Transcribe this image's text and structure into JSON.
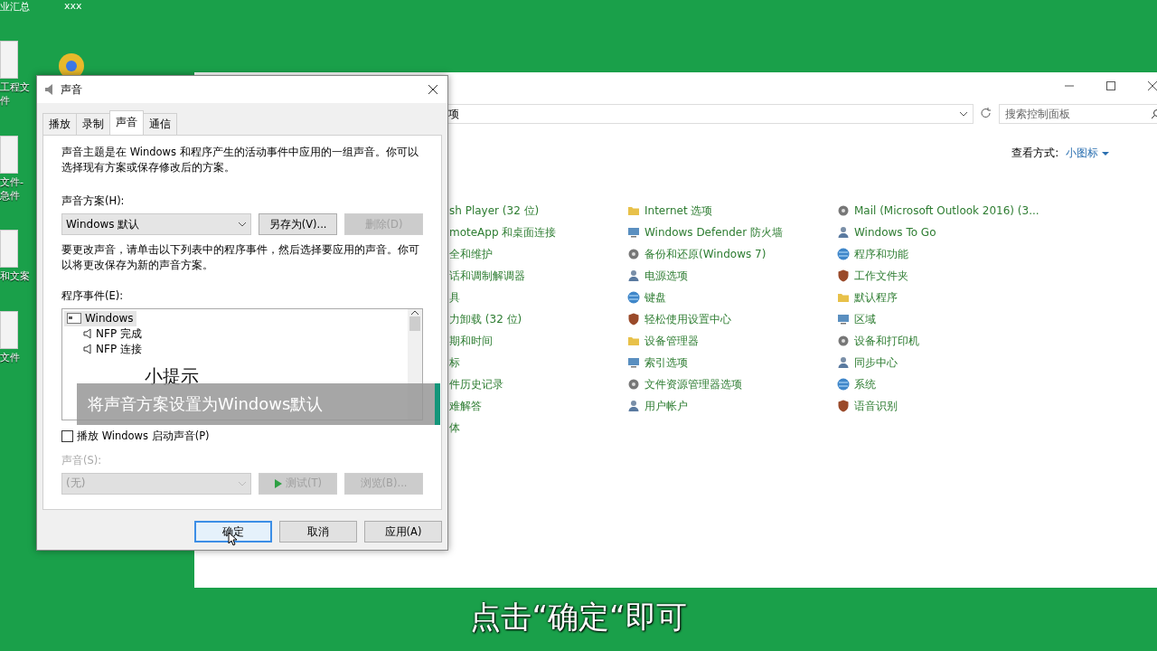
{
  "desktop": {
    "top_labels": [
      "业汇总",
      "xxx"
    ],
    "icons": [
      {
        "label": "工程文件"
      },
      {
        "label": "文件-急件"
      },
      {
        "label": "和文案"
      },
      {
        "label": "文件"
      }
    ]
  },
  "control_panel": {
    "address": "项",
    "search": {
      "placeholder": "搜索控制面板"
    },
    "view_by": {
      "label": "查看方式:",
      "value": "小图标"
    },
    "columns": [
      [
        "sh Player (32 位)",
        "moteApp 和桌面连接",
        "全和维护",
        "话和调制解调器",
        "具",
        "力卸载 (32 位)",
        "期和时间",
        "标",
        "件历史记录",
        "难解答",
        "体"
      ],
      [
        "Internet 选项",
        "Windows Defender 防火墙",
        "备份和还原(Windows 7)",
        "电源选项",
        "键盘",
        "轻松使用设置中心",
        "设备管理器",
        "索引选项",
        "文件资源管理器选项",
        "用户帐户"
      ],
      [
        "Mail (Microsoft Outlook 2016) (3...",
        "Windows To Go",
        "程序和功能",
        "工作文件夹",
        "默认程序",
        "区域",
        "设备和打印机",
        "同步中心",
        "系统",
        "语音识别"
      ]
    ]
  },
  "dialog": {
    "title": "声音",
    "tabs": [
      {
        "label": "播放",
        "selected": false
      },
      {
        "label": "录制",
        "selected": false
      },
      {
        "label": "声音",
        "selected": true
      },
      {
        "label": "通信",
        "selected": false
      }
    ],
    "intro": "声音主题是在 Windows 和程序产生的活动事件中应用的一组声音。你可以选择现有方案或保存修改后的方案。",
    "scheme_label": "声音方案(H):",
    "scheme": "Windows 默认",
    "scheme_buttons": [
      {
        "label": "另存为(V)...",
        "disabled": false
      },
      {
        "label": "删除(D)",
        "disabled": true
      }
    ],
    "hint": "要更改声音，请单击以下列表中的程序事件，然后选择要应用的声音。你可以将更改保存为新的声音方案。",
    "events_label": "程序事件(E):",
    "events": [
      {
        "label": "Windows",
        "selected": true,
        "children": [
          {
            "label": "NFP 完成",
            "selected": false
          },
          {
            "label": "NFP 连接",
            "selected": false
          }
        ]
      }
    ],
    "startup": {
      "label": "播放 Windows 启动声音(P)",
      "checked": false
    },
    "sound_label": "声音(S):",
    "sound": "(无)",
    "sound_disabled": true,
    "sound_buttons": [
      {
        "label": "测试(T)",
        "disabled": true,
        "kind": "play"
      },
      {
        "label": "浏览(B)...",
        "disabled": true,
        "kind": "plain"
      }
    ],
    "footer": [
      {
        "label": "确定",
        "selected": true
      },
      {
        "label": "取消",
        "selected": false
      },
      {
        "label": "应用(A)",
        "selected": false
      }
    ]
  },
  "tip": {
    "title": "小提示",
    "text": "将声音方案设置为Windows默认"
  },
  "subtitle": "点击“确定“即可"
}
